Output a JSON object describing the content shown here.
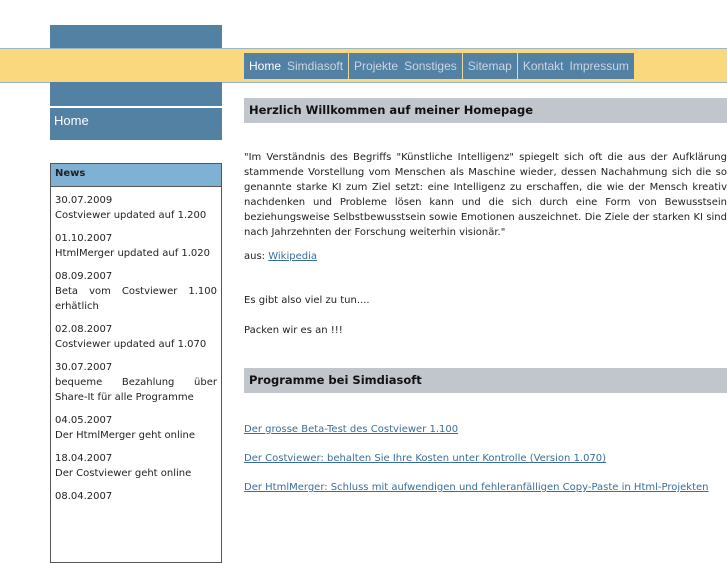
{
  "nav": {
    "groups": [
      [
        "Home",
        "Simdiasoft"
      ],
      [
        "Projekte",
        "Sonstiges"
      ],
      [
        "Sitemap"
      ],
      [
        "Kontakt",
        "Impressum"
      ]
    ]
  },
  "sidebar": {
    "home": "Home",
    "news_title": "News",
    "news": [
      {
        "date": "30.07.2009",
        "text": "Costviewer updated auf 1.200"
      },
      {
        "date": "01.10.2007",
        "text": "HtmlMerger updated auf 1.020"
      },
      {
        "date": "08.09.2007",
        "text": "Beta vom Costviewer 1.100 erhätlich"
      },
      {
        "date": "02.08.2007",
        "text": "Costviewer updated auf 1.070"
      },
      {
        "date": "30.07.2007",
        "text": "bequeme Bezahlung über Share-It für alle Programme"
      },
      {
        "date": "04.05.2007",
        "text": "Der HtmlMerger geht online"
      },
      {
        "date": "18.04.2007",
        "text": "Der Costviewer geht online"
      },
      {
        "date": "08.04.2007",
        "text": ""
      }
    ]
  },
  "main": {
    "heading1": "Herzlich Willkommen auf meiner Homepage",
    "quote": "\"Im Verständnis des Begriffs \"Künstliche Intelligenz\" spiegelt sich oft die aus der Aufklärung stammende Vorstellung vom Menschen als Maschine wieder, dessen Nachahmung sich die so genannte starke KI zum Ziel setzt: eine Intelligenz zu erschaffen, die wie der Mensch kreativ nachdenken und Probleme lösen kann und die sich durch eine Form von Bewusstsein beziehungsweise Selbstbewusstsein sowie Emotionen auszeichnet. Die Ziele der starken KI sind nach Jahrzehnten der Forschung weiterhin visionär.\"",
    "source_label": "aus:",
    "source_link": "Wikipedia",
    "line1": "Es gibt also viel zu tun....",
    "line2": "Packen wir es an !!!",
    "heading2": "Programme bei Simdiasoft",
    "links": [
      "Der grosse Beta-Test des Costviewer 1.100",
      "Der Costviewer: behalten Sie Ihre Kosten unter Kontrolle (Version 1.070)",
      "Der HtmlMerger: Schluss mit aufwendigen und fehleranfälligen Copy-Paste in Html-Projekten"
    ]
  }
}
